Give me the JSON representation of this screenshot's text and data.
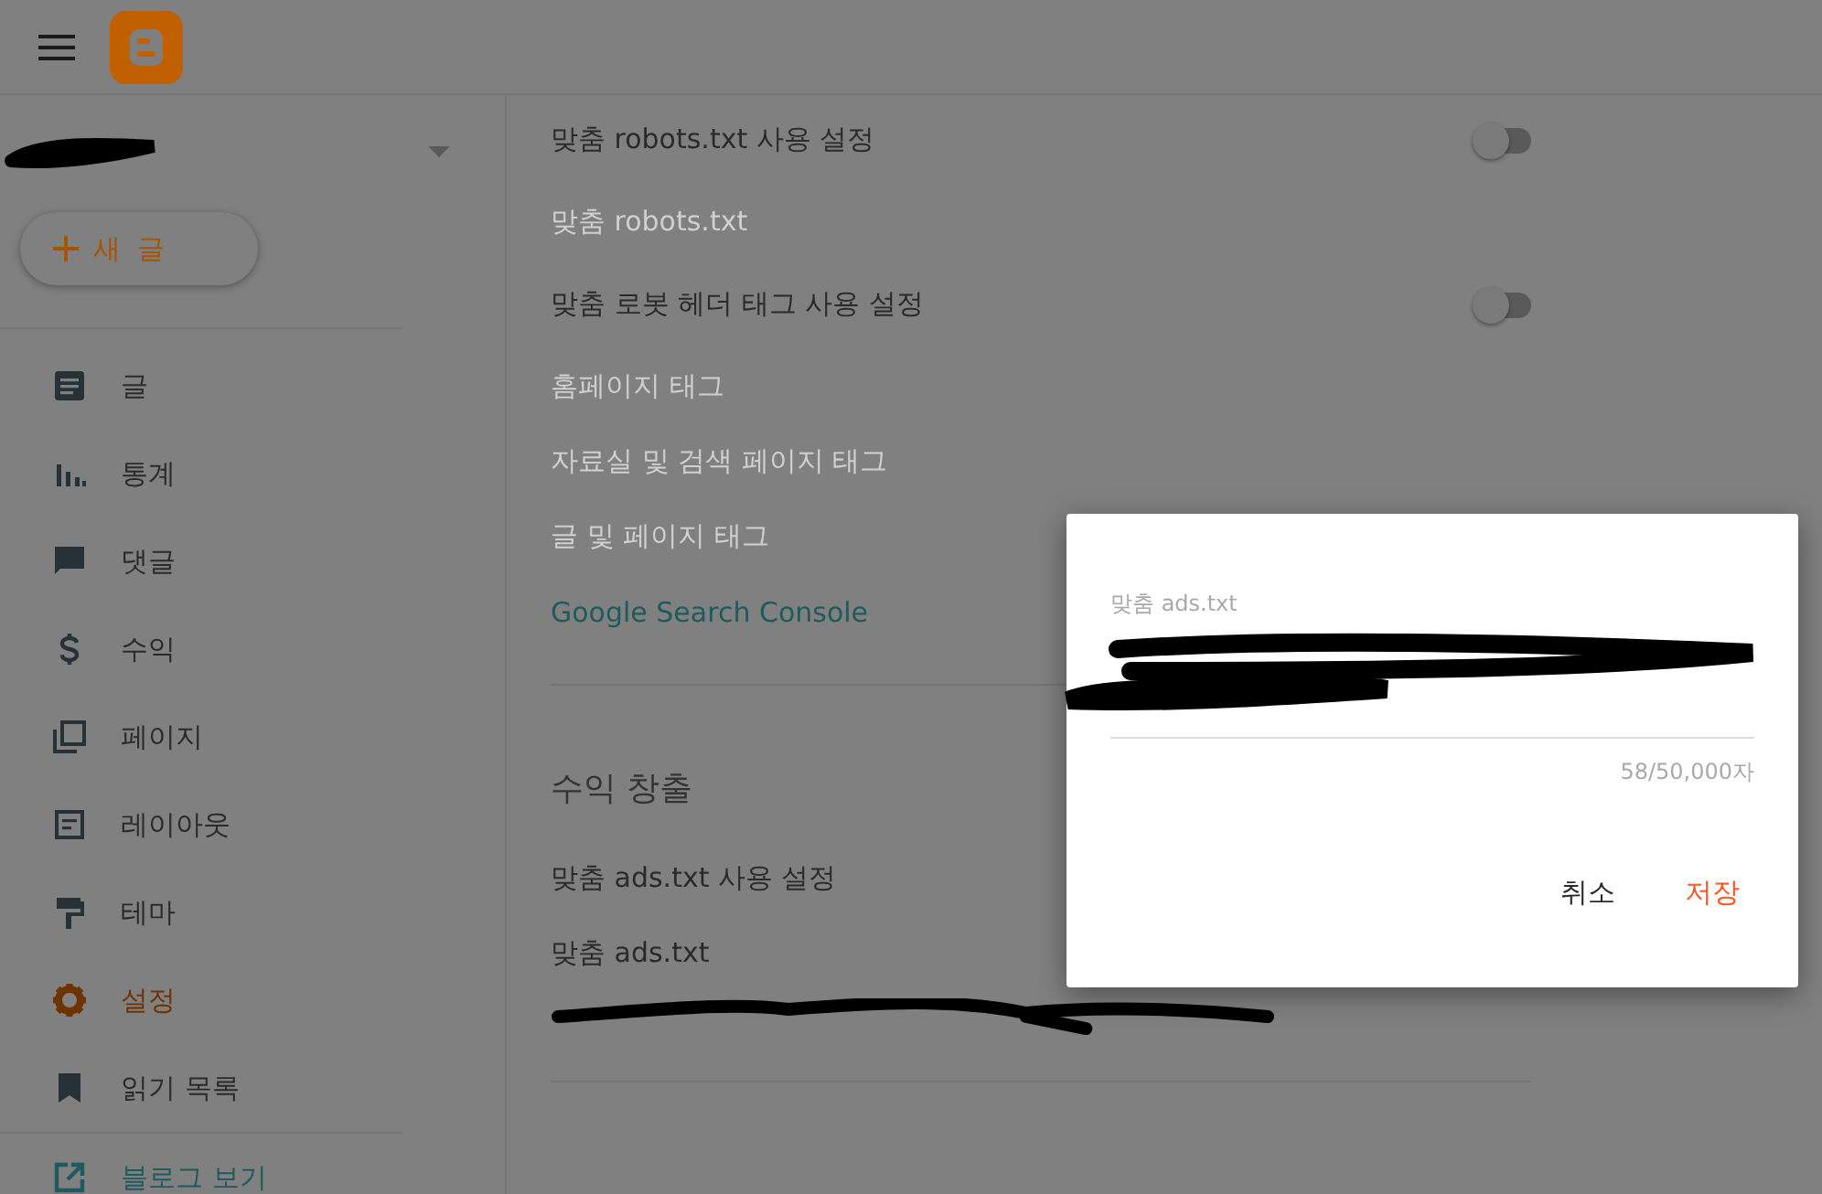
{
  "sidebar": {
    "new_post_button": "새 글",
    "nav_items": [
      {
        "label": "글",
        "selected": false
      },
      {
        "label": "통계",
        "selected": false
      },
      {
        "label": "댓글",
        "selected": false
      },
      {
        "label": "수익",
        "selected": false
      },
      {
        "label": "페이지",
        "selected": false
      },
      {
        "label": "레이아웃",
        "selected": false
      },
      {
        "label": "테마",
        "selected": false
      },
      {
        "label": "설정",
        "selected": true
      },
      {
        "label": "읽기 목록",
        "selected": false
      }
    ],
    "footer_items": [
      {
        "label": "블로그 보기"
      }
    ]
  },
  "settings": [
    {
      "kind": "toggle",
      "label": "맞춤 robots.txt 사용 설정",
      "on": false
    },
    {
      "kind": "item",
      "label": "맞춤 robots.txt",
      "disabled": true
    },
    {
      "kind": "toggle",
      "label": "맞춤 로봇 헤더 태그 사용 설정",
      "on": false
    },
    {
      "kind": "item",
      "label": "홈페이지 태그",
      "disabled": true
    },
    {
      "kind": "item",
      "label": "자료실 및 검색 페이지 태그",
      "disabled": true
    },
    {
      "kind": "item",
      "label": "글 및 페이지 태그",
      "disabled": true
    },
    {
      "kind": "link",
      "label": "Google Search Console"
    },
    {
      "kind": "divider"
    },
    {
      "kind": "heading",
      "label": "수익 창출"
    },
    {
      "kind": "item",
      "label": "맞춤 ads.txt 사용 설정",
      "disabled": false
    },
    {
      "kind": "item",
      "label": "맞춤 ads.txt",
      "disabled": false
    },
    {
      "kind": "redacted"
    },
    {
      "kind": "divider"
    }
  ],
  "dialog": {
    "field_label": "맞춤 ads.txt",
    "counter": "58/50,000자",
    "buttons": [
      {
        "label": "취소",
        "primary": false
      },
      {
        "label": "저장",
        "primary": true
      }
    ]
  }
}
